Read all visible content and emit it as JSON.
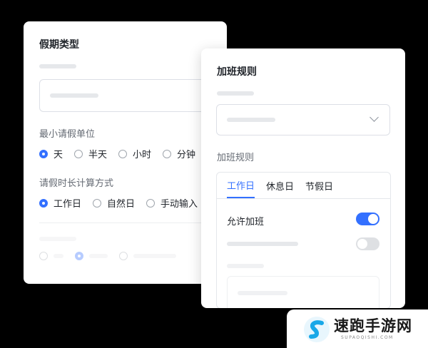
{
  "left_card": {
    "title": "假期类型",
    "min_unit_label": "最小请假单位",
    "min_unit_options": [
      "天",
      "半天",
      "小时",
      "分钟"
    ],
    "duration_label": "请假时长计算方式",
    "duration_options": [
      "工作日",
      "自然日",
      "手动输入"
    ]
  },
  "right_card": {
    "title": "加班规则",
    "rules_label": "加班规则",
    "tabs": [
      "工作日",
      "休息日",
      "节假日"
    ],
    "allow_overtime_label": "允许加班"
  },
  "logo": {
    "name": "速跑手游网",
    "url": "SUPAOQISHI.COM"
  },
  "colors": {
    "accent": "#3370ff",
    "toggle_off": "#dee0e3",
    "placeholder": "#e6e8eb"
  }
}
